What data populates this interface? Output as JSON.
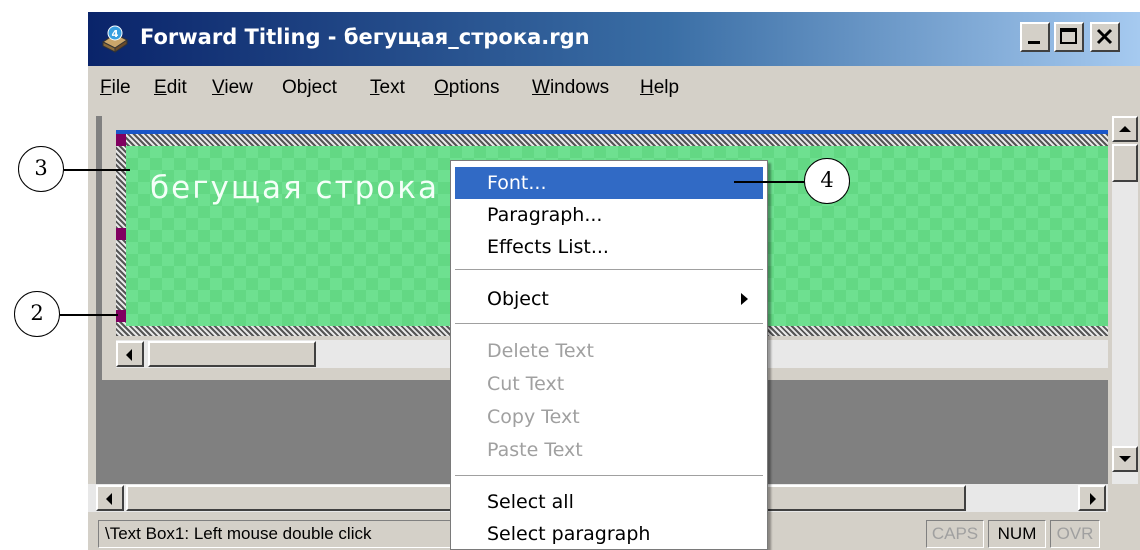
{
  "window": {
    "title": "Forward Titling - бегущая_строка.rgn"
  },
  "title_buttons": {
    "minimize_icon": "minimize-icon",
    "maximize_icon": "maximize-icon",
    "close_icon": "close-icon"
  },
  "menu": [
    {
      "label": "File",
      "u": "F",
      "rest": "ile"
    },
    {
      "label": "Edit",
      "u": "E",
      "rest": "dit"
    },
    {
      "label": "View",
      "u": "V",
      "rest": "iew"
    },
    {
      "label": "Object",
      "u": "",
      "rest": "Object"
    },
    {
      "label": "Text",
      "u": "T",
      "rest": "ext"
    },
    {
      "label": "Options",
      "u": "O",
      "rest": "ptions"
    },
    {
      "label": "Windows",
      "u": "W",
      "rest": "indows"
    },
    {
      "label": "Help",
      "u": "H",
      "rest": "elp"
    }
  ],
  "canvas": {
    "text": "бегущая строка",
    "colors": {
      "background": "#6ee090",
      "handle": "#800060",
      "frame_accent": "#1a56c8"
    }
  },
  "context_menu": {
    "items": {
      "font": "Font...",
      "paragraph": "Paragraph...",
      "effects_list": "Effects List...",
      "object": "Object",
      "delete_text": "Delete Text",
      "cut_text": "Cut Text",
      "copy_text": "Copy Text",
      "paste_text": "Paste Text",
      "select_all": "Select all",
      "select_paragraph": "Select paragraph"
    },
    "selected": "Font...",
    "disabled": [
      "Delete Text",
      "Cut Text",
      "Copy Text",
      "Paste Text"
    ]
  },
  "statusbar": {
    "text": "\\Text Box1: Left mouse double click",
    "caps": "CAPS",
    "num": "NUM",
    "ovr": "OVR"
  },
  "callouts": {
    "three": "3",
    "four": "4",
    "two": "2"
  }
}
